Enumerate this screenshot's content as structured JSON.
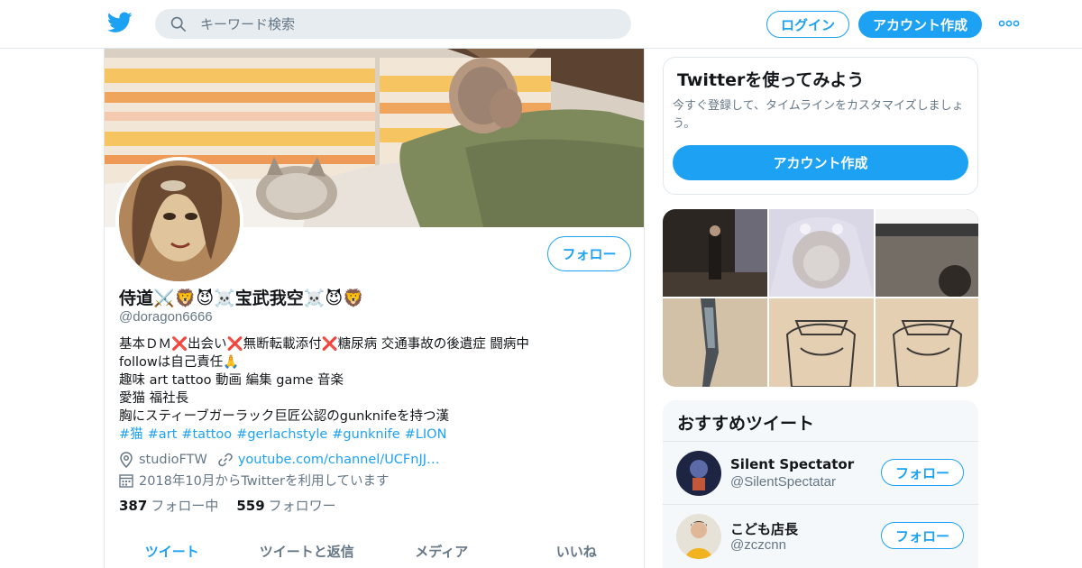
{
  "header": {
    "search_placeholder": "キーワード検索",
    "login_label": "ログイン",
    "signup_label": "アカウント作成"
  },
  "profile": {
    "display_name": "侍道⚔️🦁😈☠️宝武我空☠️😈🦁",
    "handle": "@doragon6666",
    "follow_label": "フォロー",
    "bio_lines": [
      "基本ＤＭ❌出会い❌無断転載添付❌糖尿病 交通事故の後遺症 闘病中",
      "followは自己責任🙏",
      "趣味 art tattoo 動画 編集 game 音楽",
      "愛猫 福社長",
      "胸にスティーブガーラック巨匠公認のgunknifeを持つ漢"
    ],
    "hashtags": [
      "#猫",
      "#art",
      "#tattoo",
      "#gerlachstyle",
      "#gunknife",
      "#LION"
    ],
    "location": "studioFTW",
    "url": "youtube.com/channel/UCFnJJ…",
    "joined": "2018年10月からTwitterを利用しています",
    "following_count": "387",
    "following_label": "フォロー中",
    "followers_count": "559",
    "followers_label": "フォロワー"
  },
  "tabs": [
    {
      "label": "ツイート",
      "active": true
    },
    {
      "label": "ツイートと返信",
      "active": false
    },
    {
      "label": "メディア",
      "active": false
    },
    {
      "label": "いいね",
      "active": false
    }
  ],
  "signup_card": {
    "title": "Twitterを使ってみよう",
    "description": "今すぐ登録して、タイムラインをカスタマイズしましょう。",
    "button_label": "アカウント作成"
  },
  "recommendations": {
    "title": "おすすめツイート",
    "users": [
      {
        "name": "Silent Spectator",
        "handle": "@SilentSpectatar",
        "follow_label": "フォロー"
      },
      {
        "name": "こども店長",
        "handle": "@zczcnn",
        "follow_label": "フォロー"
      }
    ]
  },
  "colors": {
    "accent": "#1da1f2",
    "text": "#14171a",
    "secondary_text": "#657786",
    "border": "#e1e8ed"
  },
  "icons": [
    "twitter-bird-icon",
    "search-icon",
    "more-icon",
    "location-icon",
    "link-icon",
    "calendar-icon"
  ]
}
